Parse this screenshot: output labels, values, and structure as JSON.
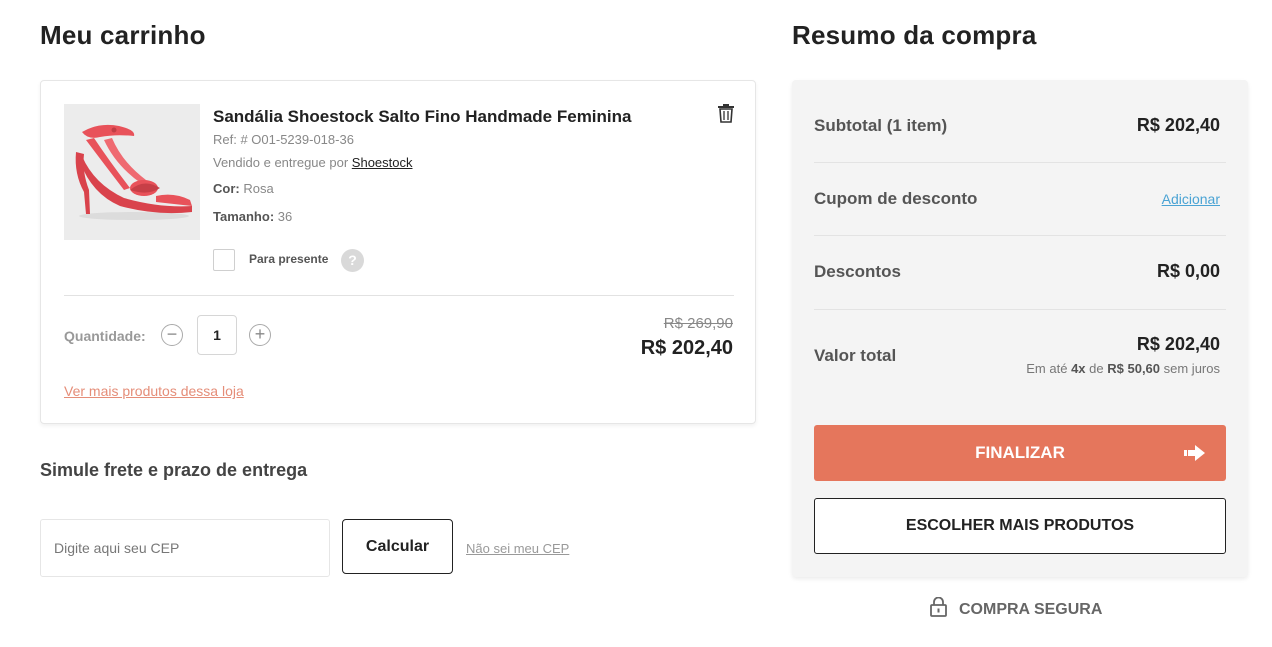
{
  "cart": {
    "title": "Meu carrinho",
    "item": {
      "name": "Sandália Shoestock Salto Fino Handmade Feminina",
      "ref": "Ref: # O01-5239-018-36",
      "seller_prefix": "Vendido e entregue por",
      "seller": "Shoestock",
      "color_label": "Cor:",
      "color": "Rosa",
      "size_label": "Tamanho:",
      "size": "36",
      "gift_label": "Para presente",
      "help_symbol": "?",
      "quantity_label": "Quantidade:",
      "quantity": "1",
      "decrement": "−",
      "increment": "+",
      "old_price": "R$ 269,90",
      "price": "R$ 202,40",
      "more_link": "Ver mais produtos dessa loja",
      "shoe_color": "#e8525a"
    }
  },
  "shipping": {
    "title": "Simule frete e prazo de entrega",
    "cep_placeholder": "Digite aqui seu CEP",
    "calc_button": "Calcular",
    "unknown_cep_link": "Não sei meu CEP"
  },
  "summary": {
    "title": "Resumo da compra",
    "subtotal_label": "Subtotal (1 item)",
    "subtotal_value": "R$ 202,40",
    "coupon_label": "Cupom de desconto",
    "coupon_link": "Adicionar",
    "discount_label": "Descontos",
    "discount_value": "R$ 0,00",
    "total_label": "Valor total",
    "total_value": "R$ 202,40",
    "installments_prefix": "Em até",
    "installments_count": "4x",
    "installments_mid": "de",
    "installments_value": "R$ 50,60",
    "installments_suffix": "sem juros",
    "finish_button": "FINALIZAR",
    "more_products_button": "ESCOLHER MAIS PRODUTOS",
    "secure_label": "COMPRA SEGURA",
    "accent_color": "#e5765c"
  }
}
